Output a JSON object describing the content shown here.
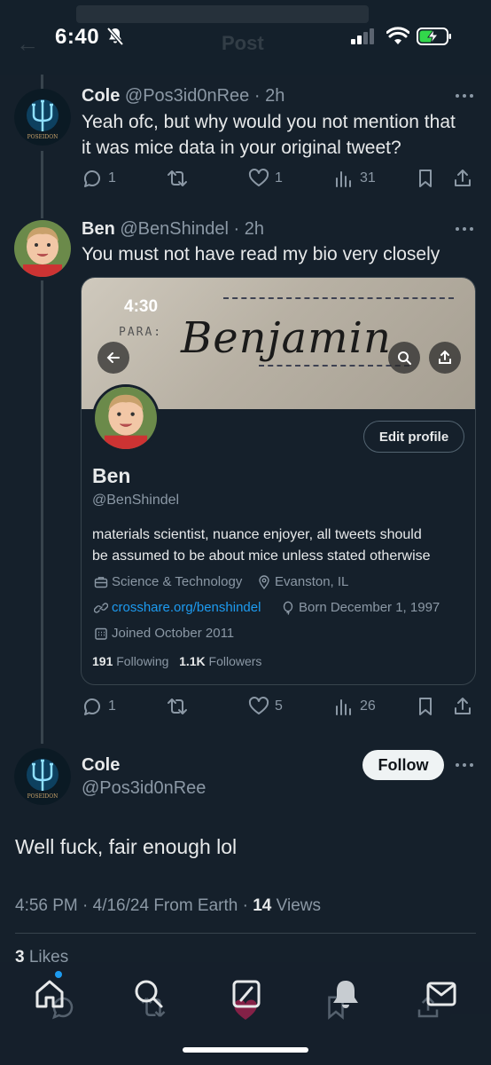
{
  "status_bar": {
    "time": "6:40",
    "ghost_title": "Post"
  },
  "tweets": [
    {
      "name": "Cole",
      "handle": "@Pos3id0nRee",
      "age": "2h",
      "avatar": "poseidon-trident-avatar",
      "text_lines": [
        "Yeah ofc, but why would you not mention that",
        "it was mice data in your original tweet?"
      ],
      "replies": "1",
      "retweets": "",
      "likes": "1",
      "views": "31"
    },
    {
      "name": "Ben",
      "handle": "@BenShindel",
      "age": "2h",
      "avatar": "child-photo-avatar",
      "text_lines": [
        "You must not have read my bio very closely"
      ],
      "replies": "1",
      "retweets": "",
      "likes": "5",
      "views": "26"
    }
  ],
  "profile_card": {
    "banner_time": "4:30",
    "banner_para": "PARA:",
    "banner_handwriting": "Benjamin",
    "edit_profile": "Edit profile",
    "name": "Ben",
    "handle": "@BenShindel",
    "bio_lines": [
      "materials scientist, nuance enjoyer, all tweets should",
      "be assumed to be about mice unless stated otherwise"
    ],
    "category": "Science & Technology",
    "location": "Evanston, IL",
    "website": "crosshare.org/benshindel",
    "born": "Born December 1, 1997",
    "joined": "Joined October 2011",
    "following_count": "191",
    "following_label": "Following",
    "followers_count": "1.1K",
    "followers_label": "Followers"
  },
  "main_tweet": {
    "name": "Cole",
    "handle": "@Pos3id0nRee",
    "follow": "Follow",
    "text": "Well fuck, fair enough lol",
    "timestamp": "4:56 PM · 4/16/24 From Earth · ",
    "views_count": "14",
    "views_label": "Views",
    "likes_count": "3",
    "likes_label": "Likes"
  },
  "colors": {
    "background": "#15202b",
    "accent": "#1d9bf0",
    "muted": "#8b98a5",
    "compose_accent": "#e0245e"
  }
}
